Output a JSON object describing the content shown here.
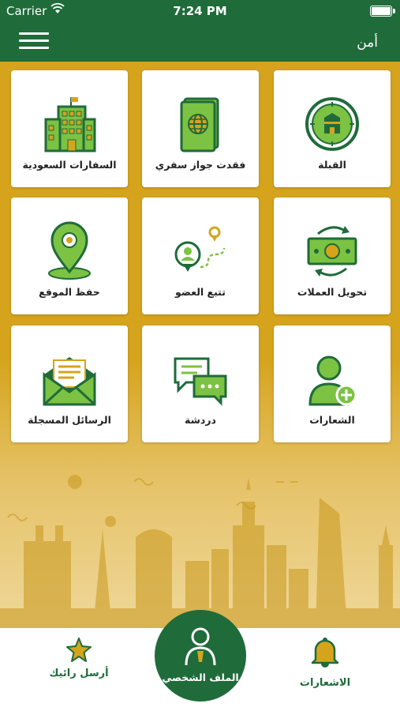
{
  "status_bar": {
    "carrier": "Carrier",
    "time": "7:24 PM"
  },
  "header": {
    "title": "أمن"
  },
  "tiles": [
    {
      "label": "القبلة",
      "icon": "qibla-icon"
    },
    {
      "label": "فقدت جواز سفري",
      "icon": "passport-icon"
    },
    {
      "label": "السفارات السعودية",
      "icon": "embassy-building-icon"
    },
    {
      "label": "تحويل العملات",
      "icon": "currency-exchange-icon"
    },
    {
      "label": "تتبع العضو",
      "icon": "track-member-icon"
    },
    {
      "label": "حفظ الموقع",
      "icon": "location-pin-icon"
    },
    {
      "label": "الشعارات",
      "icon": "user-add-icon"
    },
    {
      "label": "دردشة",
      "icon": "chat-icon"
    },
    {
      "label": "الرسائل المسجلة",
      "icon": "envelope-icon"
    }
  ],
  "bottom_nav": {
    "feedback": "أرسل رائيك",
    "profile": "الملف الشخصي",
    "notifications": "الاشعارات"
  },
  "colors": {
    "primary_green": "#1f6b3a",
    "gold": "#d6a41c",
    "icon_light_green": "#7cc243"
  }
}
